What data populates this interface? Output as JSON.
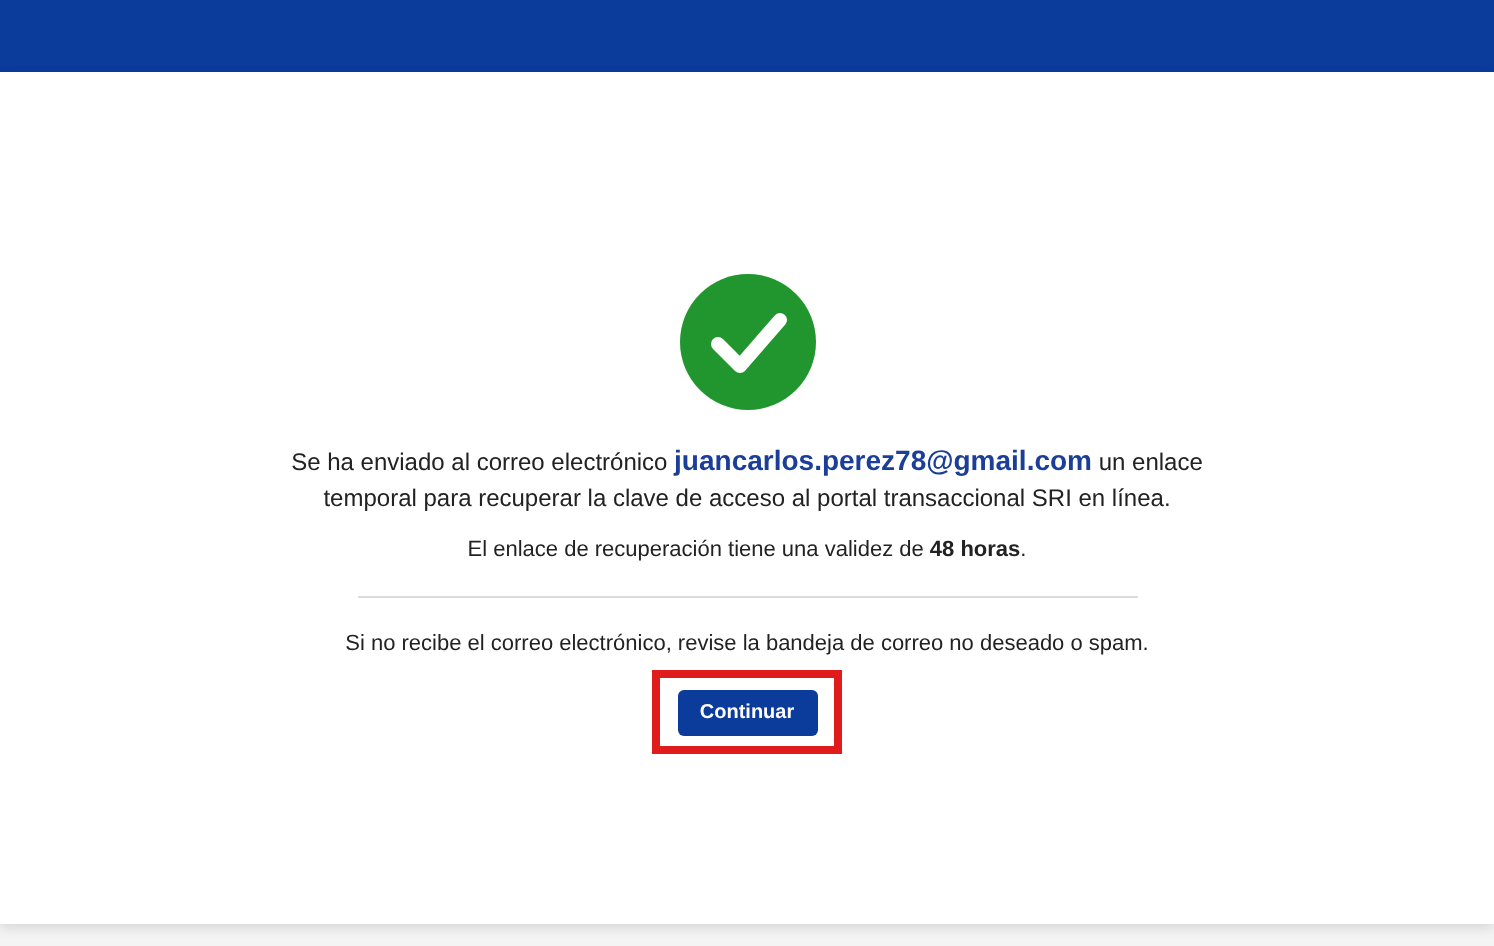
{
  "header": {
    "kind": "bar"
  },
  "message": {
    "segments": [
      {
        "kind": "plain",
        "text": "Se ha enviado al correo electrónico "
      },
      {
        "kind": "email",
        "text": "juancarlos.perez78@gmail.com"
      },
      {
        "kind": "plain",
        "text": " un enlace temporal para recuperar la clave de acceso al portal transaccional SRI en línea."
      }
    ]
  },
  "validity": "El enlace de recuperación tiene una validez de **48 horas**.",
  "hint": "Si no recibe el correo electrónico, revise la bandeja de correo no deseado o spam.",
  "button": {
    "label": "Continuar",
    "highlighted": true
  }
}
